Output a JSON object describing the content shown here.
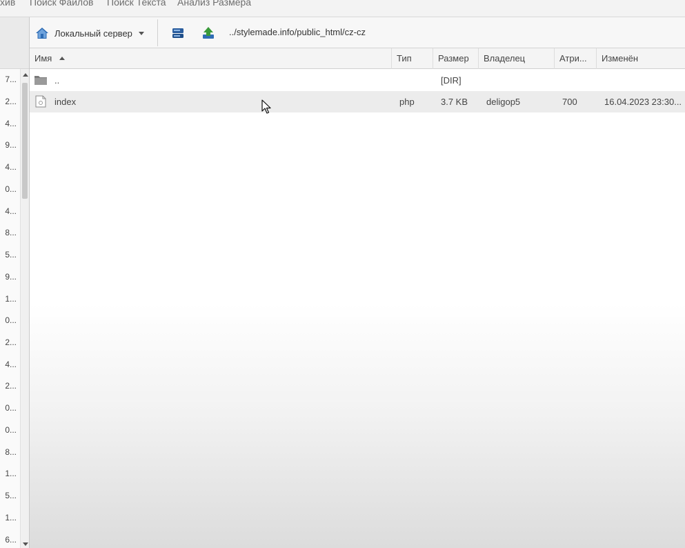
{
  "top_menu": {
    "items": [
      "хив",
      "Поиск Файлов",
      "Поиск Текста",
      "Анализ Размера"
    ]
  },
  "left_panel": {
    "items": [
      "7...",
      "2...",
      "4...",
      "9...",
      "4...",
      "0...",
      "4...",
      "8...",
      "5...",
      "9...",
      "1...",
      "0...",
      "2...",
      "4...",
      "2...",
      "0...",
      "0...",
      "8...",
      "1...",
      "5...",
      "1...",
      "6..."
    ]
  },
  "toolbar": {
    "server_label": "Локальный сервер",
    "path": "../stylemade.info/public_html/cz-cz",
    "icons": [
      "home-icon",
      "server-icon",
      "upload-icon"
    ]
  },
  "grid": {
    "columns": {
      "name": "Имя",
      "type": "Тип",
      "size": "Размер",
      "owner": "Владелец",
      "attr": "Атри...",
      "modified": "Изменён"
    },
    "sorted_column": "name",
    "sort_direction": "ascending",
    "rows": [
      {
        "name": "..",
        "type": "",
        "size": "[DIR]",
        "owner": "",
        "attr": "",
        "modified": "",
        "icon": "folder-icon"
      },
      {
        "name": "index",
        "type": "php",
        "size": "3.7 KB",
        "owner": "deligop5",
        "attr": "700",
        "modified": "16.04.2023 23:30...",
        "icon": "php-file-icon"
      }
    ],
    "selected_row": 1
  },
  "colors": {
    "accent_blue": "#2f6db5",
    "upload_green": "#3a9a3a",
    "selected_row": "#ececec"
  }
}
